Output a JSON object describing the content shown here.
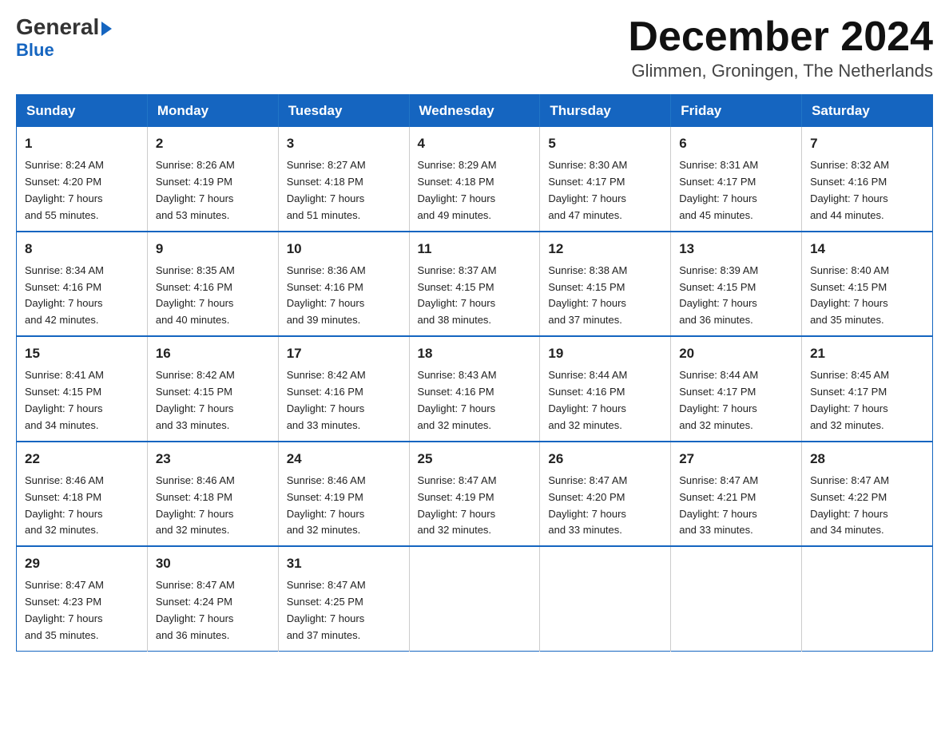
{
  "header": {
    "logo_general": "General",
    "logo_blue": "Blue",
    "month_title": "December 2024",
    "location": "Glimmen, Groningen, The Netherlands"
  },
  "weekdays": [
    "Sunday",
    "Monday",
    "Tuesday",
    "Wednesday",
    "Thursday",
    "Friday",
    "Saturday"
  ],
  "weeks": [
    [
      {
        "day": "1",
        "info": "Sunrise: 8:24 AM\nSunset: 4:20 PM\nDaylight: 7 hours\nand 55 minutes."
      },
      {
        "day": "2",
        "info": "Sunrise: 8:26 AM\nSunset: 4:19 PM\nDaylight: 7 hours\nand 53 minutes."
      },
      {
        "day": "3",
        "info": "Sunrise: 8:27 AM\nSunset: 4:18 PM\nDaylight: 7 hours\nand 51 minutes."
      },
      {
        "day": "4",
        "info": "Sunrise: 8:29 AM\nSunset: 4:18 PM\nDaylight: 7 hours\nand 49 minutes."
      },
      {
        "day": "5",
        "info": "Sunrise: 8:30 AM\nSunset: 4:17 PM\nDaylight: 7 hours\nand 47 minutes."
      },
      {
        "day": "6",
        "info": "Sunrise: 8:31 AM\nSunset: 4:17 PM\nDaylight: 7 hours\nand 45 minutes."
      },
      {
        "day": "7",
        "info": "Sunrise: 8:32 AM\nSunset: 4:16 PM\nDaylight: 7 hours\nand 44 minutes."
      }
    ],
    [
      {
        "day": "8",
        "info": "Sunrise: 8:34 AM\nSunset: 4:16 PM\nDaylight: 7 hours\nand 42 minutes."
      },
      {
        "day": "9",
        "info": "Sunrise: 8:35 AM\nSunset: 4:16 PM\nDaylight: 7 hours\nand 40 minutes."
      },
      {
        "day": "10",
        "info": "Sunrise: 8:36 AM\nSunset: 4:16 PM\nDaylight: 7 hours\nand 39 minutes."
      },
      {
        "day": "11",
        "info": "Sunrise: 8:37 AM\nSunset: 4:15 PM\nDaylight: 7 hours\nand 38 minutes."
      },
      {
        "day": "12",
        "info": "Sunrise: 8:38 AM\nSunset: 4:15 PM\nDaylight: 7 hours\nand 37 minutes."
      },
      {
        "day": "13",
        "info": "Sunrise: 8:39 AM\nSunset: 4:15 PM\nDaylight: 7 hours\nand 36 minutes."
      },
      {
        "day": "14",
        "info": "Sunrise: 8:40 AM\nSunset: 4:15 PM\nDaylight: 7 hours\nand 35 minutes."
      }
    ],
    [
      {
        "day": "15",
        "info": "Sunrise: 8:41 AM\nSunset: 4:15 PM\nDaylight: 7 hours\nand 34 minutes."
      },
      {
        "day": "16",
        "info": "Sunrise: 8:42 AM\nSunset: 4:15 PM\nDaylight: 7 hours\nand 33 minutes."
      },
      {
        "day": "17",
        "info": "Sunrise: 8:42 AM\nSunset: 4:16 PM\nDaylight: 7 hours\nand 33 minutes."
      },
      {
        "day": "18",
        "info": "Sunrise: 8:43 AM\nSunset: 4:16 PM\nDaylight: 7 hours\nand 32 minutes."
      },
      {
        "day": "19",
        "info": "Sunrise: 8:44 AM\nSunset: 4:16 PM\nDaylight: 7 hours\nand 32 minutes."
      },
      {
        "day": "20",
        "info": "Sunrise: 8:44 AM\nSunset: 4:17 PM\nDaylight: 7 hours\nand 32 minutes."
      },
      {
        "day": "21",
        "info": "Sunrise: 8:45 AM\nSunset: 4:17 PM\nDaylight: 7 hours\nand 32 minutes."
      }
    ],
    [
      {
        "day": "22",
        "info": "Sunrise: 8:46 AM\nSunset: 4:18 PM\nDaylight: 7 hours\nand 32 minutes."
      },
      {
        "day": "23",
        "info": "Sunrise: 8:46 AM\nSunset: 4:18 PM\nDaylight: 7 hours\nand 32 minutes."
      },
      {
        "day": "24",
        "info": "Sunrise: 8:46 AM\nSunset: 4:19 PM\nDaylight: 7 hours\nand 32 minutes."
      },
      {
        "day": "25",
        "info": "Sunrise: 8:47 AM\nSunset: 4:19 PM\nDaylight: 7 hours\nand 32 minutes."
      },
      {
        "day": "26",
        "info": "Sunrise: 8:47 AM\nSunset: 4:20 PM\nDaylight: 7 hours\nand 33 minutes."
      },
      {
        "day": "27",
        "info": "Sunrise: 8:47 AM\nSunset: 4:21 PM\nDaylight: 7 hours\nand 33 minutes."
      },
      {
        "day": "28",
        "info": "Sunrise: 8:47 AM\nSunset: 4:22 PM\nDaylight: 7 hours\nand 34 minutes."
      }
    ],
    [
      {
        "day": "29",
        "info": "Sunrise: 8:47 AM\nSunset: 4:23 PM\nDaylight: 7 hours\nand 35 minutes."
      },
      {
        "day": "30",
        "info": "Sunrise: 8:47 AM\nSunset: 4:24 PM\nDaylight: 7 hours\nand 36 minutes."
      },
      {
        "day": "31",
        "info": "Sunrise: 8:47 AM\nSunset: 4:25 PM\nDaylight: 7 hours\nand 37 minutes."
      },
      null,
      null,
      null,
      null
    ]
  ]
}
